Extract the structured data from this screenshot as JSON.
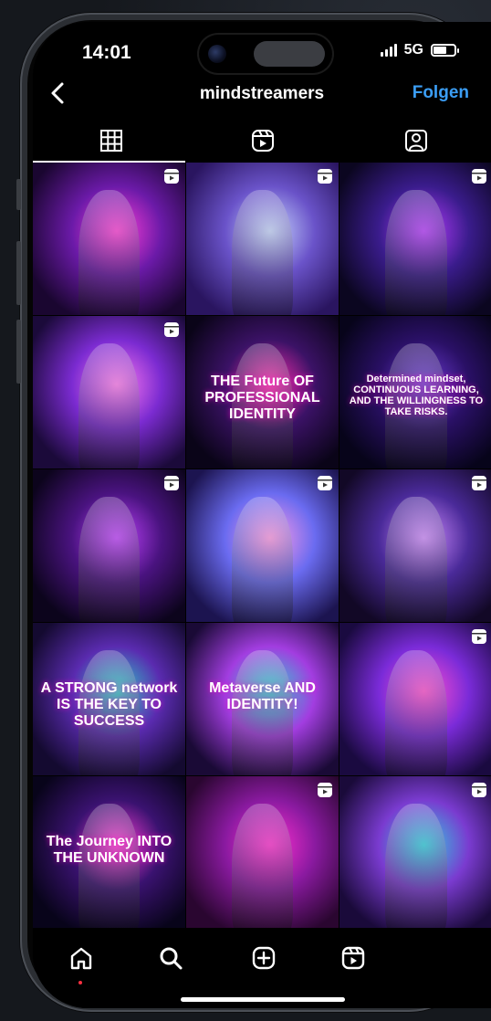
{
  "status": {
    "time": "14:01",
    "network": "5G"
  },
  "header": {
    "title": "mindstreamers",
    "follow_label": "Folgen"
  },
  "tabs": [
    {
      "icon": "grid-icon",
      "active": true
    },
    {
      "icon": "reels-icon",
      "active": false
    },
    {
      "icon": "tagged-icon",
      "active": false
    }
  ],
  "posts": [
    {
      "scene": "hooded-figure-neon",
      "text": "",
      "reel": true
    },
    {
      "scene": "cartoon-monster-pumpkins",
      "text": "",
      "reel": true
    },
    {
      "scene": "bitcoin-man",
      "text": "",
      "reel": true
    },
    {
      "scene": "girl-glasses-smile",
      "text": "",
      "reel": true
    },
    {
      "scene": "vr-headset",
      "text": "THE Future OF PROFESSIONAL IDENTITY",
      "reel": false
    },
    {
      "scene": "city-quote",
      "text": "Determined mindset, CONTINUOUS LEARNING, AND THE WILLINGNESS TO TAKE RISKS.",
      "reel": false
    },
    {
      "scene": "neon-compass",
      "text": "",
      "reel": true
    },
    {
      "scene": "flower-mask-girl",
      "text": "",
      "reel": true
    },
    {
      "scene": "suit-bags",
      "text": "",
      "reel": true
    },
    {
      "scene": "network-group",
      "text": "A STRONG network IS THE KEY TO SUCCESS",
      "reel": false
    },
    {
      "scene": "metaverse-identity",
      "text": "Metaverse AND IDENTITY!",
      "reel": false
    },
    {
      "scene": "headphones-woman",
      "text": "",
      "reel": true
    },
    {
      "scene": "journey-unknown",
      "text": "The Journey INTO THE UNKNOWN",
      "reel": false
    },
    {
      "scene": "sitting-pink",
      "text": "",
      "reel": true
    },
    {
      "scene": "young-man-hoodie",
      "text": "",
      "reel": true
    }
  ],
  "bottom_nav": [
    {
      "icon": "home-icon"
    },
    {
      "icon": "search-icon"
    },
    {
      "icon": "create-icon"
    },
    {
      "icon": "reels-icon"
    }
  ],
  "colors": {
    "accent": "#3b9ef5",
    "background": "#000000"
  }
}
